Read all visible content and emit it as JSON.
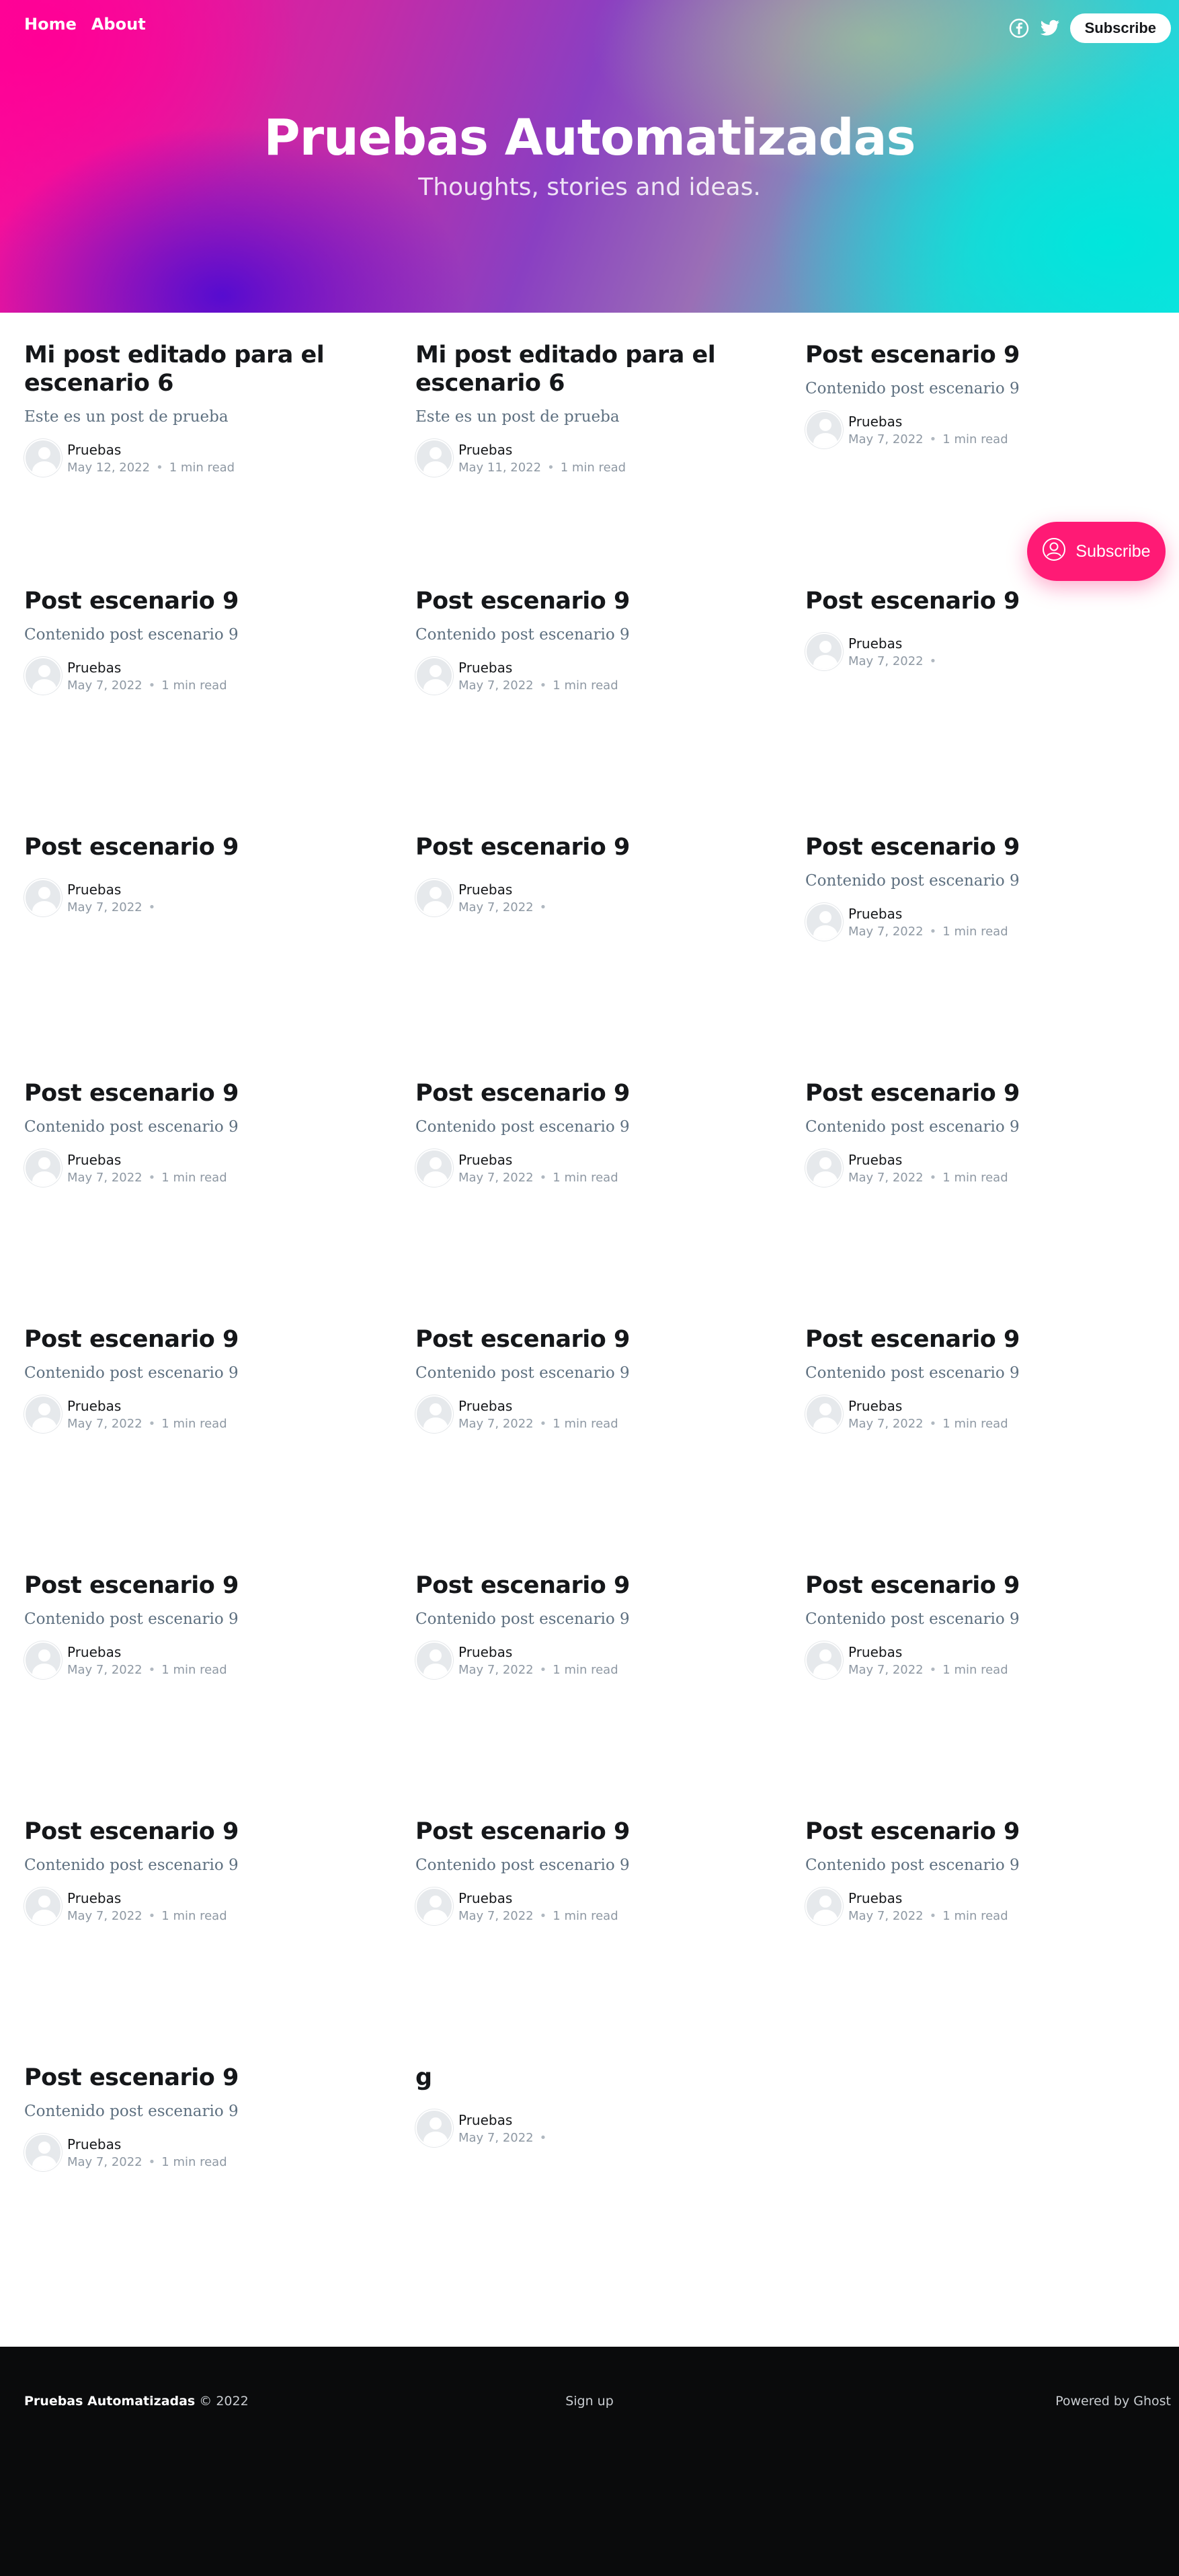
{
  "nav": {
    "home": "Home",
    "about": "About",
    "subscribe": "Subscribe"
  },
  "site": {
    "title": "Pruebas Automatizadas",
    "description": "Thoughts, stories and ideas."
  },
  "float_subscribe": "Subscribe",
  "posts": [
    {
      "title": "Mi post editado para el escenario 6",
      "excerpt": "Este es un post de prueba",
      "author": "Pruebas",
      "date": "May 12, 2022",
      "read": "1 min read"
    },
    {
      "title": "Mi post editado para el escenario 6",
      "excerpt": "Este es un post de prueba",
      "author": "Pruebas",
      "date": "May 11, 2022",
      "read": "1 min read"
    },
    {
      "title": "Post escenario 9",
      "excerpt": "Contenido post escenario 9",
      "author": "Pruebas",
      "date": "May 7, 2022",
      "read": "1 min read"
    },
    {
      "title": "Post escenario 9",
      "excerpt": "Contenido post escenario 9",
      "author": "Pruebas",
      "date": "May 7, 2022",
      "read": "1 min read"
    },
    {
      "title": "Post escenario 9",
      "excerpt": "Contenido post escenario 9",
      "author": "Pruebas",
      "date": "May 7, 2022",
      "read": "1 min read"
    },
    {
      "title": "Post escenario 9",
      "excerpt": "",
      "author": "Pruebas",
      "date": "May 7, 2022",
      "read": ""
    },
    {
      "title": "Post escenario 9",
      "excerpt": "",
      "author": "Pruebas",
      "date": "May 7, 2022",
      "read": ""
    },
    {
      "title": "Post escenario 9",
      "excerpt": "",
      "author": "Pruebas",
      "date": "May 7, 2022",
      "read": ""
    },
    {
      "title": "Post escenario 9",
      "excerpt": "Contenido post escenario 9",
      "author": "Pruebas",
      "date": "May 7, 2022",
      "read": "1 min read"
    },
    {
      "title": "Post escenario 9",
      "excerpt": "Contenido post escenario 9",
      "author": "Pruebas",
      "date": "May 7, 2022",
      "read": "1 min read"
    },
    {
      "title": "Post escenario 9",
      "excerpt": "Contenido post escenario 9",
      "author": "Pruebas",
      "date": "May 7, 2022",
      "read": "1 min read"
    },
    {
      "title": "Post escenario 9",
      "excerpt": "Contenido post escenario 9",
      "author": "Pruebas",
      "date": "May 7, 2022",
      "read": "1 min read"
    },
    {
      "title": "Post escenario 9",
      "excerpt": "Contenido post escenario 9",
      "author": "Pruebas",
      "date": "May 7, 2022",
      "read": "1 min read"
    },
    {
      "title": "Post escenario 9",
      "excerpt": "Contenido post escenario 9",
      "author": "Pruebas",
      "date": "May 7, 2022",
      "read": "1 min read"
    },
    {
      "title": "Post escenario 9",
      "excerpt": "Contenido post escenario 9",
      "author": "Pruebas",
      "date": "May 7, 2022",
      "read": "1 min read"
    },
    {
      "title": "Post escenario 9",
      "excerpt": "Contenido post escenario 9",
      "author": "Pruebas",
      "date": "May 7, 2022",
      "read": "1 min read"
    },
    {
      "title": "Post escenario 9",
      "excerpt": "Contenido post escenario 9",
      "author": "Pruebas",
      "date": "May 7, 2022",
      "read": "1 min read"
    },
    {
      "title": "Post escenario 9",
      "excerpt": "Contenido post escenario 9",
      "author": "Pruebas",
      "date": "May 7, 2022",
      "read": "1 min read"
    },
    {
      "title": "Post escenario 9",
      "excerpt": "Contenido post escenario 9",
      "author": "Pruebas",
      "date": "May 7, 2022",
      "read": "1 min read"
    },
    {
      "title": "Post escenario 9",
      "excerpt": "Contenido post escenario 9",
      "author": "Pruebas",
      "date": "May 7, 2022",
      "read": "1 min read"
    },
    {
      "title": "Post escenario 9",
      "excerpt": "Contenido post escenario 9",
      "author": "Pruebas",
      "date": "May 7, 2022",
      "read": "1 min read"
    },
    {
      "title": "Post escenario 9",
      "excerpt": "Contenido post escenario 9",
      "author": "Pruebas",
      "date": "May 7, 2022",
      "read": "1 min read"
    },
    {
      "title": "g",
      "excerpt": "",
      "author": "Pruebas",
      "date": "May 7, 2022",
      "read": ""
    }
  ],
  "footer": {
    "site_name": "Pruebas Automatizadas",
    "copyright": "© 2022",
    "signup": "Sign up",
    "powered": "Powered by Ghost"
  },
  "colors": {
    "accent": "#ff1a75",
    "footer_bg": "#0a0b0c"
  }
}
